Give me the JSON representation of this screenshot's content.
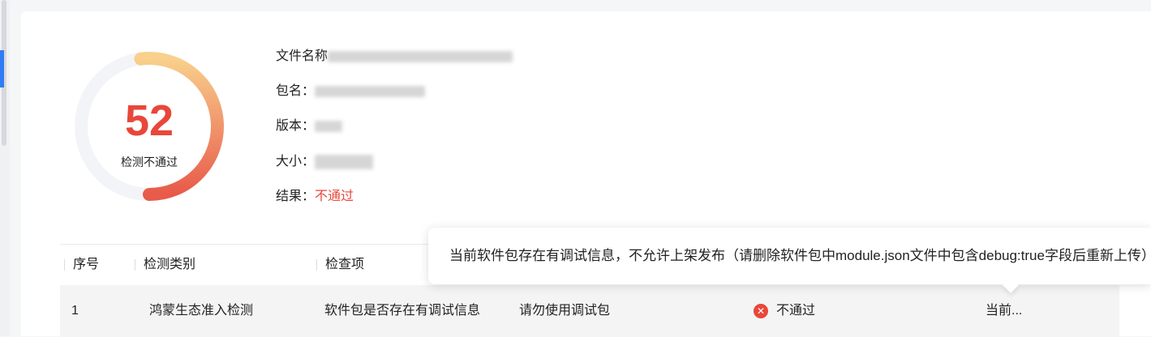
{
  "score": {
    "value": "52",
    "label": "检测不通过",
    "progress_fraction": 0.52,
    "colors": {
      "start": "#e85a4a",
      "end": "#f9d08c",
      "track": "#f3f4f8"
    }
  },
  "info": {
    "file_name_label": "文件名称",
    "package_label": "包名：",
    "version_label": "版本：",
    "size_label": "大小：",
    "result_label": "结果：",
    "result_value": "不通过"
  },
  "table": {
    "headers": [
      "序号",
      "检测类别",
      "检查项"
    ],
    "row": {
      "index": "1",
      "category": "鸿蒙生态准入检测",
      "check_item": "软件包是否存在有调试信息",
      "suggestion": "请勿使用调试包",
      "status": "不通过",
      "detail": "当前..."
    }
  },
  "tooltip": {
    "text": "当前软件包存在有调试信息，不允许上架发布（请删除软件包中module.json文件中包含debug:true字段后重新上传）"
  },
  "colors": {
    "accent": "#2f7cf6",
    "fail": "#e8473a"
  }
}
